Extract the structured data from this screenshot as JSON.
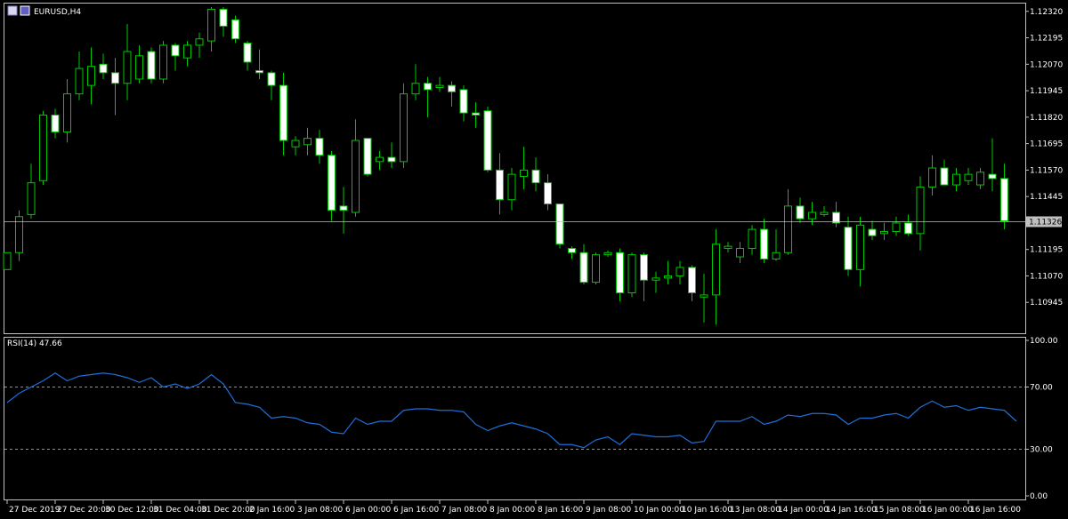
{
  "window": {
    "symbol_title": "EURUSD,H4"
  },
  "colors": {
    "background": "#000000",
    "frame": "#c0c0c0",
    "bull_body": "#000000",
    "bear_body": "#ffffff",
    "wick": "#00c800",
    "bull_outline": "#00c800",
    "price_line": "#c0c0c0",
    "rsi_line": "#1e6fd9",
    "level_line": "#c0c0c0",
    "text": "#ffffff",
    "price_label_bg": "#c0c0c0",
    "price_label_text": "#000000"
  },
  "chart_data": [
    {
      "type": "candlestick",
      "title": "EURUSD,H4",
      "ylim": [
        1.1082,
        1.1234
      ],
      "y_ticks": [
        "1.12320",
        "1.12195",
        "1.12070",
        "1.11945",
        "1.11820",
        "1.11695",
        "1.11570",
        "1.11445",
        "1.11195",
        "1.11070",
        "1.10945"
      ],
      "current_price": "1.11326",
      "x_tick_labels": [
        "27 Dec 2019",
        "27 Dec 20:00",
        "30 Dec 12:00",
        "31 Dec 04:00",
        "31 Dec 20:00",
        "2 Jan 16:00",
        "3 Jan 08:00",
        "6 Jan 00:00",
        "6 Jan 16:00",
        "7 Jan 08:00",
        "8 Jan 00:00",
        "8 Jan 16:00",
        "9 Jan 08:00",
        "10 Jan 00:00",
        "10 Jan 16:00",
        "13 Jan 08:00",
        "14 Jan 00:00",
        "14 Jan 16:00",
        "15 Jan 08:00",
        "16 Jan 00:00",
        "16 Jan 16:00"
      ],
      "x_tick_positions": [
        0,
        4,
        8,
        12,
        16,
        20,
        24,
        28,
        32,
        36,
        40,
        44,
        48,
        52,
        56,
        60,
        64,
        68,
        72,
        76,
        80
      ],
      "candles": [
        {
          "o": 1.111,
          "h": 1.1118,
          "l": 1.111,
          "c": 1.1118
        },
        {
          "o": 1.1118,
          "h": 1.1138,
          "l": 1.1114,
          "c": 1.1135
        },
        {
          "o": 1.1136,
          "h": 1.116,
          "l": 1.1134,
          "c": 1.1151
        },
        {
          "o": 1.1152,
          "h": 1.1185,
          "l": 1.115,
          "c": 1.1183
        },
        {
          "o": 1.1183,
          "h": 1.1186,
          "l": 1.1172,
          "c": 1.1175
        },
        {
          "o": 1.1175,
          "h": 1.12,
          "l": 1.117,
          "c": 1.1193
        },
        {
          "o": 1.1193,
          "h": 1.1213,
          "l": 1.119,
          "c": 1.1205
        },
        {
          "o": 1.1197,
          "h": 1.1215,
          "l": 1.1188,
          "c": 1.1206
        },
        {
          "o": 1.1207,
          "h": 1.1212,
          "l": 1.12,
          "c": 1.1203
        },
        {
          "o": 1.1203,
          "h": 1.121,
          "l": 1.1183,
          "c": 1.1198
        },
        {
          "o": 1.1198,
          "h": 1.1226,
          "l": 1.119,
          "c": 1.1213
        },
        {
          "o": 1.12,
          "h": 1.1216,
          "l": 1.1198,
          "c": 1.1211
        },
        {
          "o": 1.1213,
          "h": 1.1215,
          "l": 1.1198,
          "c": 1.12
        },
        {
          "o": 1.12,
          "h": 1.1218,
          "l": 1.1198,
          "c": 1.1216
        },
        {
          "o": 1.1216,
          "h": 1.1217,
          "l": 1.1204,
          "c": 1.1211
        },
        {
          "o": 1.121,
          "h": 1.1218,
          "l": 1.1206,
          "c": 1.1216
        },
        {
          "o": 1.1216,
          "h": 1.1222,
          "l": 1.121,
          "c": 1.1219
        },
        {
          "o": 1.1218,
          "h": 1.1234,
          "l": 1.1213,
          "c": 1.1233
        },
        {
          "o": 1.1233,
          "h": 1.1234,
          "l": 1.122,
          "c": 1.1225
        },
        {
          "o": 1.1228,
          "h": 1.123,
          "l": 1.1217,
          "c": 1.1219
        },
        {
          "o": 1.1217,
          "h": 1.1218,
          "l": 1.1204,
          "c": 1.1208
        },
        {
          "o": 1.1204,
          "h": 1.1214,
          "l": 1.12,
          "c": 1.1203
        },
        {
          "o": 1.1203,
          "h": 1.1204,
          "l": 1.119,
          "c": 1.1197
        },
        {
          "o": 1.1197,
          "h": 1.1203,
          "l": 1.1164,
          "c": 1.1171
        },
        {
          "o": 1.1168,
          "h": 1.1173,
          "l": 1.1164,
          "c": 1.1171
        },
        {
          "o": 1.1169,
          "h": 1.1177,
          "l": 1.1164,
          "c": 1.1172
        },
        {
          "o": 1.1172,
          "h": 1.1176,
          "l": 1.116,
          "c": 1.1164
        },
        {
          "o": 1.1164,
          "h": 1.1166,
          "l": 1.1133,
          "c": 1.1138
        },
        {
          "o": 1.114,
          "h": 1.1149,
          "l": 1.1127,
          "c": 1.1138
        },
        {
          "o": 1.1137,
          "h": 1.1181,
          "l": 1.1135,
          "c": 1.1171
        },
        {
          "o": 1.1172,
          "h": 1.1172,
          "l": 1.1154,
          "c": 1.1155
        },
        {
          "o": 1.1161,
          "h": 1.1166,
          "l": 1.1157,
          "c": 1.1163
        },
        {
          "o": 1.1163,
          "h": 1.117,
          "l": 1.1158,
          "c": 1.1161
        },
        {
          "o": 1.1161,
          "h": 1.1198,
          "l": 1.1158,
          "c": 1.1193
        },
        {
          "o": 1.1193,
          "h": 1.1207,
          "l": 1.119,
          "c": 1.1198
        },
        {
          "o": 1.1198,
          "h": 1.1201,
          "l": 1.1182,
          "c": 1.1195
        },
        {
          "o": 1.1196,
          "h": 1.1201,
          "l": 1.1194,
          "c": 1.1197
        },
        {
          "o": 1.1197,
          "h": 1.1199,
          "l": 1.1187,
          "c": 1.1194
        },
        {
          "o": 1.1195,
          "h": 1.1197,
          "l": 1.118,
          "c": 1.1184
        },
        {
          "o": 1.1184,
          "h": 1.1189,
          "l": 1.1177,
          "c": 1.1183
        },
        {
          "o": 1.1185,
          "h": 1.1187,
          "l": 1.1156,
          "c": 1.1157
        },
        {
          "o": 1.1157,
          "h": 1.1165,
          "l": 1.1136,
          "c": 1.1143
        },
        {
          "o": 1.1143,
          "h": 1.1158,
          "l": 1.1138,
          "c": 1.1155
        },
        {
          "o": 1.1154,
          "h": 1.1168,
          "l": 1.1148,
          "c": 1.1157
        },
        {
          "o": 1.1157,
          "h": 1.1163,
          "l": 1.1147,
          "c": 1.1151
        },
        {
          "o": 1.1151,
          "h": 1.1155,
          "l": 1.1138,
          "c": 1.1141
        },
        {
          "o": 1.1141,
          "h": 1.113,
          "l": 1.112,
          "c": 1.1122
        },
        {
          "o": 1.112,
          "h": 1.1121,
          "l": 1.1115,
          "c": 1.1118
        },
        {
          "o": 1.1118,
          "h": 1.1122,
          "l": 1.1103,
          "c": 1.1104
        },
        {
          "o": 1.1104,
          "h": 1.1118,
          "l": 1.1103,
          "c": 1.1117
        },
        {
          "o": 1.1117,
          "h": 1.1119,
          "l": 1.1116,
          "c": 1.1118
        },
        {
          "o": 1.1118,
          "h": 1.112,
          "l": 1.1095,
          "c": 1.1099
        },
        {
          "o": 1.1099,
          "h": 1.1118,
          "l": 1.1097,
          "c": 1.1117
        },
        {
          "o": 1.1117,
          "h": 1.1118,
          "l": 1.1095,
          "c": 1.1105
        },
        {
          "o": 1.1105,
          "h": 1.1109,
          "l": 1.1099,
          "c": 1.1106
        },
        {
          "o": 1.1106,
          "h": 1.1114,
          "l": 1.1103,
          "c": 1.1107
        },
        {
          "o": 1.1107,
          "h": 1.1114,
          "l": 1.1103,
          "c": 1.1111
        },
        {
          "o": 1.1111,
          "h": 1.1112,
          "l": 1.1095,
          "c": 1.1099
        },
        {
          "o": 1.1097,
          "h": 1.1108,
          "l": 1.1085,
          "c": 1.1098
        },
        {
          "o": 1.1098,
          "h": 1.1129,
          "l": 1.1084,
          "c": 1.1122
        },
        {
          "o": 1.112,
          "h": 1.1123,
          "l": 1.1118,
          "c": 1.1121
        },
        {
          "o": 1.1116,
          "h": 1.1123,
          "l": 1.1113,
          "c": 1.112
        },
        {
          "o": 1.112,
          "h": 1.1131,
          "l": 1.1117,
          "c": 1.1129
        },
        {
          "o": 1.1129,
          "h": 1.1134,
          "l": 1.1113,
          "c": 1.1115
        },
        {
          "o": 1.1115,
          "h": 1.1129,
          "l": 1.1114,
          "c": 1.1118
        },
        {
          "o": 1.1118,
          "h": 1.1148,
          "l": 1.1117,
          "c": 1.114
        },
        {
          "o": 1.114,
          "h": 1.1144,
          "l": 1.1132,
          "c": 1.1134
        },
        {
          "o": 1.1134,
          "h": 1.1142,
          "l": 1.1131,
          "c": 1.1137
        },
        {
          "o": 1.1136,
          "h": 1.114,
          "l": 1.1135,
          "c": 1.1137
        },
        {
          "o": 1.1137,
          "h": 1.1142,
          "l": 1.113,
          "c": 1.1132
        },
        {
          "o": 1.113,
          "h": 1.1135,
          "l": 1.1107,
          "c": 1.111
        },
        {
          "o": 1.111,
          "h": 1.1135,
          "l": 1.1102,
          "c": 1.1131
        },
        {
          "o": 1.1129,
          "h": 1.1133,
          "l": 1.1124,
          "c": 1.1126
        },
        {
          "o": 1.1127,
          "h": 1.1132,
          "l": 1.1124,
          "c": 1.1128
        },
        {
          "o": 1.1128,
          "h": 1.1135,
          "l": 1.1126,
          "c": 1.1132
        },
        {
          "o": 1.1132,
          "h": 1.1136,
          "l": 1.1126,
          "c": 1.1127
        },
        {
          "o": 1.1127,
          "h": 1.1154,
          "l": 1.1119,
          "c": 1.1149
        },
        {
          "o": 1.1149,
          "h": 1.1164,
          "l": 1.1145,
          "c": 1.1158
        },
        {
          "o": 1.1158,
          "h": 1.1162,
          "l": 1.1151,
          "c": 1.115
        },
        {
          "o": 1.115,
          "h": 1.1158,
          "l": 1.1147,
          "c": 1.1155
        },
        {
          "o": 1.1152,
          "h": 1.1158,
          "l": 1.115,
          "c": 1.1155
        },
        {
          "o": 1.115,
          "h": 1.1158,
          "l": 1.1148,
          "c": 1.1156
        },
        {
          "o": 1.1155,
          "h": 1.1172,
          "l": 1.1147,
          "c": 1.1153
        },
        {
          "o": 1.1153,
          "h": 1.116,
          "l": 1.1129,
          "c": 1.1133
        }
      ]
    },
    {
      "type": "line",
      "title": "RSI(14) 47.66",
      "ylim": [
        0,
        100
      ],
      "y_ticks": [
        "100.00",
        "70.00",
        "30.00",
        "0.00"
      ],
      "levels": [
        70,
        30
      ],
      "series": [
        {
          "values": [
            60,
            66,
            70,
            74,
            79,
            74,
            77,
            78,
            79,
            78,
            76,
            73,
            76,
            70,
            72,
            69,
            72,
            78,
            72,
            60,
            59,
            57,
            50,
            51,
            50,
            47,
            46,
            41,
            40,
            50,
            46,
            48,
            48,
            55,
            56,
            56,
            55,
            55,
            54,
            46,
            42,
            45,
            47,
            45,
            43,
            40,
            33,
            33,
            31,
            36,
            38,
            33,
            40,
            39,
            38,
            38,
            39,
            34,
            35,
            48,
            48,
            48,
            51,
            46,
            48,
            52,
            51,
            53,
            53,
            52,
            46,
            50,
            50,
            52,
            53,
            50,
            57,
            61,
            57,
            58,
            55,
            57,
            56,
            55,
            48
          ]
        }
      ]
    }
  ]
}
